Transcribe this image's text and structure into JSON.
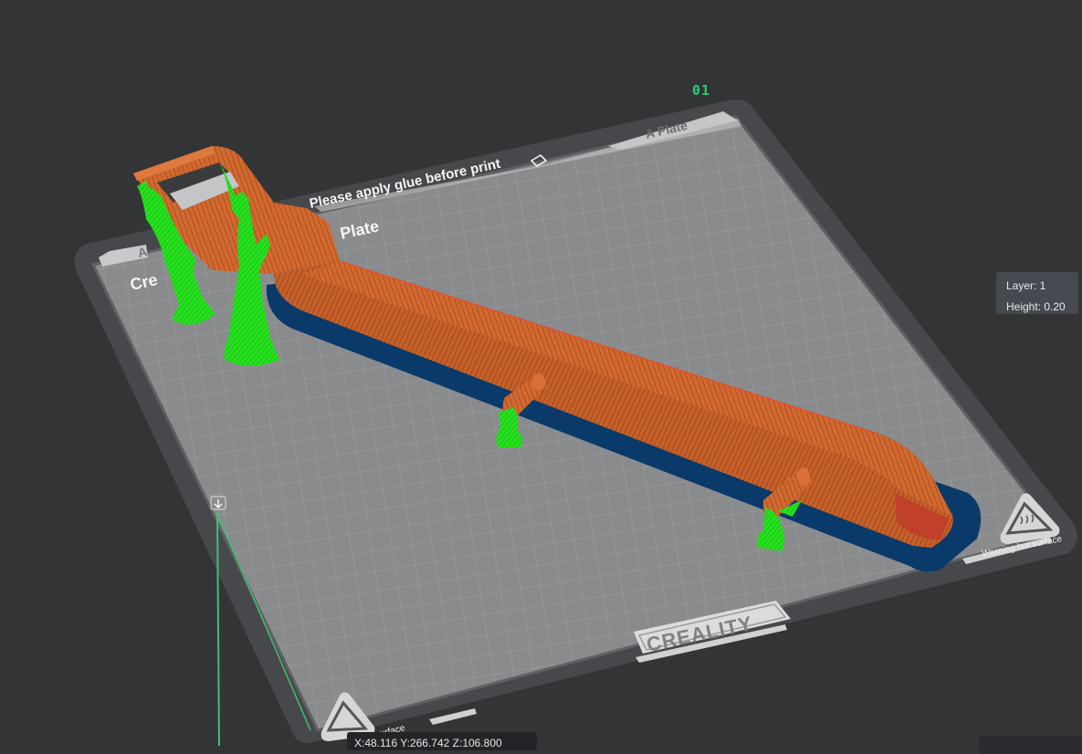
{
  "plate": {
    "index_label": "01",
    "tab_label": "A Plate",
    "note": "Please apply glue before print",
    "plate_name_text": "Plate",
    "left_tab_text": "A",
    "brand_text": "Cre",
    "logo_text": "CREALITY",
    "warning_right": "Warning hot surface",
    "warning_left": "hot surface"
  },
  "layer_info": {
    "layer_label": "Layer: 1",
    "height_label": "Height: 0.20"
  },
  "cursor_coords": "X:48.116  Y:266.742  Z:106.800",
  "colors": {
    "background": "#333436",
    "bed": "#8a8b8d",
    "grid": "#a4a5a7",
    "model": "#c9622c",
    "support": "#22dd1f",
    "brim": "#083b6c",
    "accent": "#2ecc71"
  },
  "icons": [
    "edit-icon",
    "hot-surface-icon",
    "layer-slider-icon"
  ]
}
